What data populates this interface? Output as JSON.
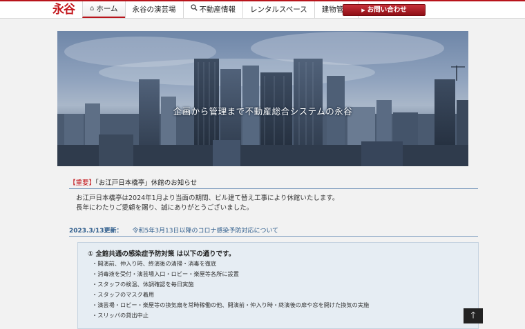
{
  "header": {
    "logo_text": "永谷",
    "nav": [
      {
        "label": "ホーム",
        "icon": "home-icon",
        "active": true
      },
      {
        "label": "永谷の演芸場",
        "icon": "",
        "active": false
      },
      {
        "label": "不動産情報",
        "icon": "search-icon",
        "active": false
      },
      {
        "label": "レンタルスペース",
        "icon": "",
        "active": false
      },
      {
        "label": "建物管理",
        "icon": "",
        "active": false
      }
    ],
    "contact_label": "お問い合わせ"
  },
  "hero": {
    "caption": "企画から管理まで不動産総合システムの永谷"
  },
  "notice": {
    "tag": "【重要】",
    "title": "「お江戸日本橋亭」休館のお知らせ",
    "lines": [
      "お江戸日本橋亭は2024年1月より当面の期間、ビル建て替え工事により休館いたします。",
      "長年にわたりご愛顧を賜り、誠にありがとうございました。"
    ]
  },
  "covid": {
    "date": "2023.3/13更新：",
    "title": "令和5年3月13日以降のコロナ感染予防対応について",
    "heading": "① 全館共通の感染症予防対策 は以下の通りです。",
    "items": [
      "・開演前、仲入り時、終演後の清掃・消毒を徹底",
      "・消毒液を受付・演芸場入口・ロビー・楽屋等各所に設置",
      "・スタッフの検温、体調確認を毎日実施",
      "・スタッフのマスク着用",
      "・演芸場・ロビー・楽屋等の換気扇を常時稼働の他、開演前・仲入り時・終演後の扉や窓を開けた換気の実施",
      "・スリッパの貸出中止"
    ]
  },
  "colors": {
    "brand_red": "#c3161c",
    "link_blue": "#2f5d8c"
  }
}
